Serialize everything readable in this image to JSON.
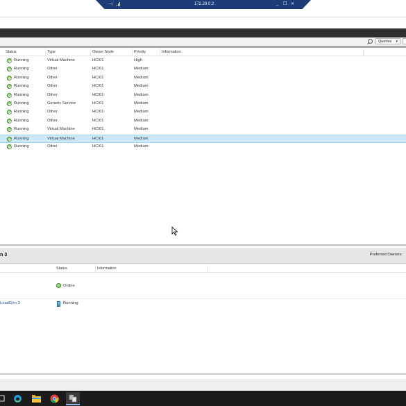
{
  "remote_bar": {
    "ip": "172.29.0.2",
    "pin_icon": "pin-icon",
    "signal_icon": "signal-icon"
  },
  "toolbar": {
    "queries_label": "Queries",
    "queries_arrow": "▾"
  },
  "columns": {
    "status": "Status",
    "type": "Type",
    "owner": "Owner Node",
    "priority": "Priority",
    "information": "Information"
  },
  "roles": [
    {
      "status": "Running",
      "type": "Virtual Machine",
      "owner": "HCI01",
      "priority": "High"
    },
    {
      "status": "Running",
      "type": "Other",
      "owner": "HCI01",
      "priority": "Medium"
    },
    {
      "status": "Running",
      "type": "Other",
      "owner": "HCI01",
      "priority": "Medium"
    },
    {
      "status": "Running",
      "type": "Other",
      "owner": "HCI01",
      "priority": "Medium"
    },
    {
      "status": "Running",
      "type": "Other",
      "owner": "HCI01",
      "priority": "Medium"
    },
    {
      "status": "Running",
      "type": "Generic Service",
      "owner": "HCI01",
      "priority": "Medium"
    },
    {
      "status": "Running",
      "type": "Other",
      "owner": "HCI01",
      "priority": "Medium"
    },
    {
      "status": "Running",
      "type": "Other",
      "owner": "HCI01",
      "priority": "Medium"
    },
    {
      "status": "Running",
      "type": "Virtual Machine",
      "owner": "HCI01",
      "priority": "Medium"
    },
    {
      "status": "Running",
      "type": "Virtual Machine",
      "owner": "HCI01",
      "priority": "Medium",
      "selected": true
    },
    {
      "status": "Running",
      "type": "Other",
      "owner": "HCI01",
      "priority": "Medium"
    }
  ],
  "details": {
    "title": "n 3",
    "preferred_owners": "Preferred Owners:",
    "columns": {
      "status": "Status",
      "information": "Information"
    },
    "resources": [
      {
        "name": "",
        "status": "Online"
      },
      {
        "name": "LoadGen 3",
        "status": "Running"
      }
    ]
  }
}
